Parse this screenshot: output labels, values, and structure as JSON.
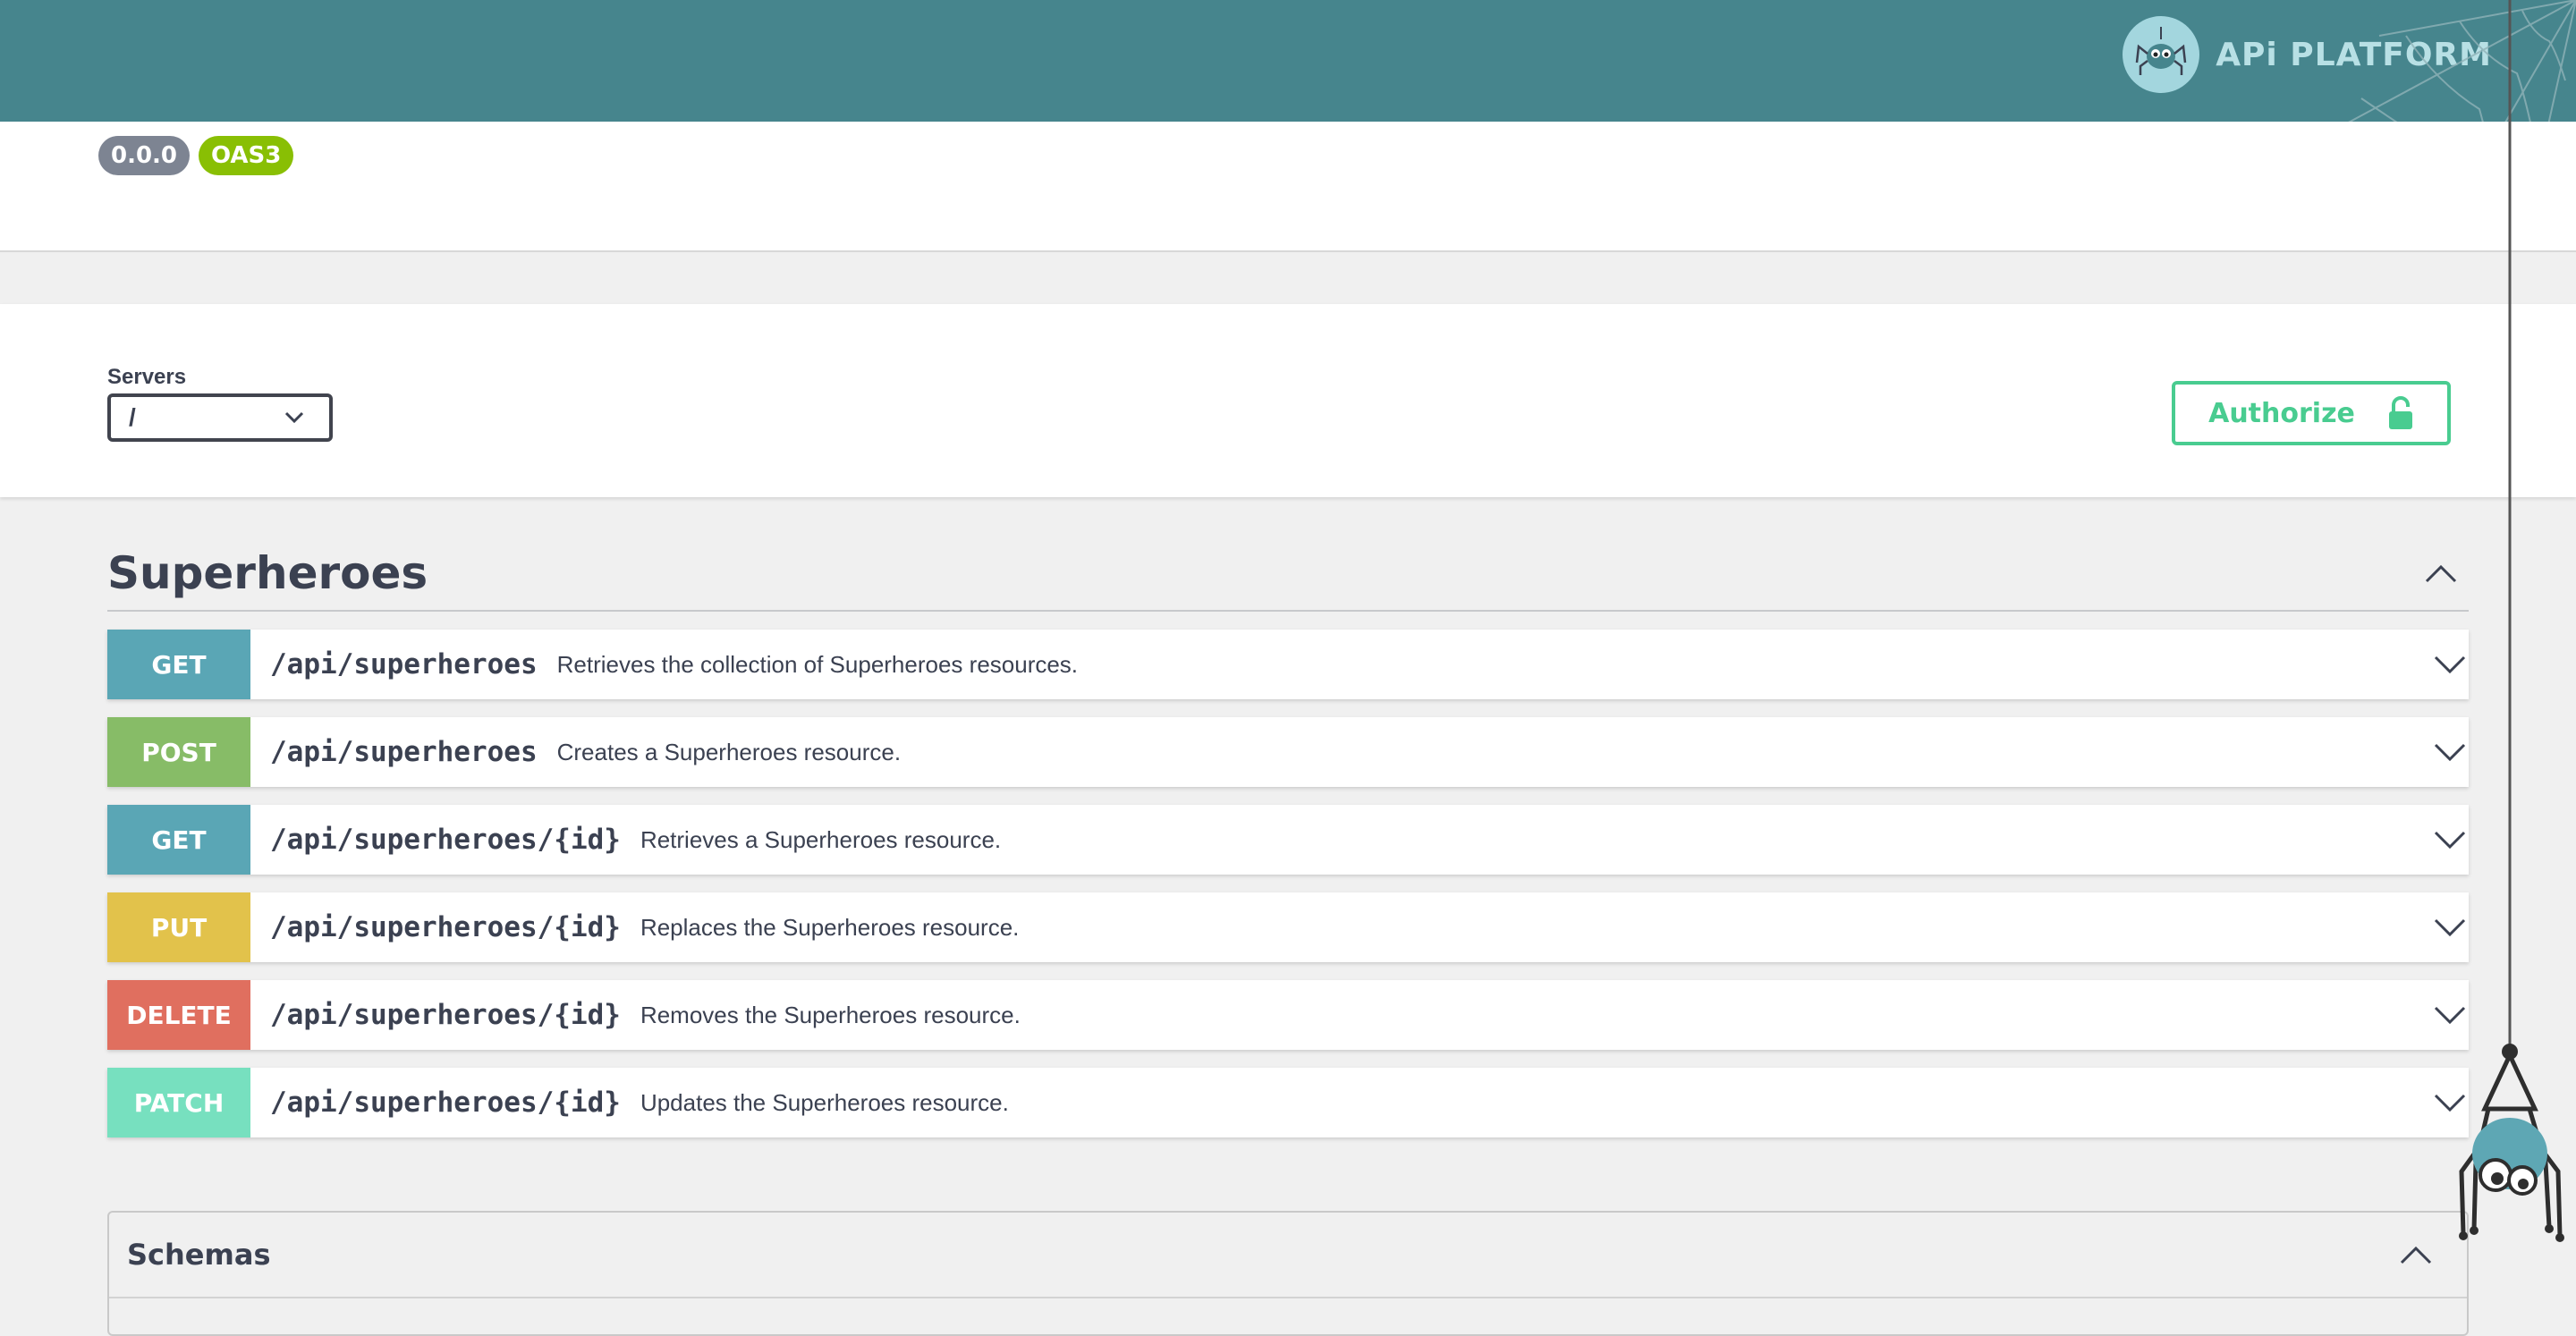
{
  "header": {
    "brand_text": "APi PLATFORM",
    "brand_icon": "spider-logo-icon",
    "background_color": "#46858d"
  },
  "info": {
    "version_badge": "0.0.0",
    "oas_badge": "OAS3"
  },
  "servers": {
    "label": "Servers",
    "selected": "/"
  },
  "authorize": {
    "label": "Authorize",
    "icon": "unlocked-padlock-icon"
  },
  "tag": {
    "title": "Superheroes",
    "expanded": true
  },
  "operations": [
    {
      "method": "GET",
      "path": "/api/superheroes",
      "summary": "Retrieves the collection of Superheroes resources.",
      "color": "#5aa6b5"
    },
    {
      "method": "POST",
      "path": "/api/superheroes",
      "summary": "Creates a Superheroes resource.",
      "color": "#87bc67"
    },
    {
      "method": "GET",
      "path": "/api/superheroes/{id}",
      "summary": "Retrieves a Superheroes resource.",
      "color": "#5aa6b5"
    },
    {
      "method": "PUT",
      "path": "/api/superheroes/{id}",
      "summary": "Replaces the Superheroes resource.",
      "color": "#e2c24b"
    },
    {
      "method": "DELETE",
      "path": "/api/superheroes/{id}",
      "summary": "Removes the Superheroes resource.",
      "color": "#e06f5f"
    },
    {
      "method": "PATCH",
      "path": "/api/superheroes/{id}",
      "summary": "Updates the Superheroes resource.",
      "color": "#77e0bf"
    }
  ],
  "schemas": {
    "title": "Schemas",
    "expanded": true
  }
}
